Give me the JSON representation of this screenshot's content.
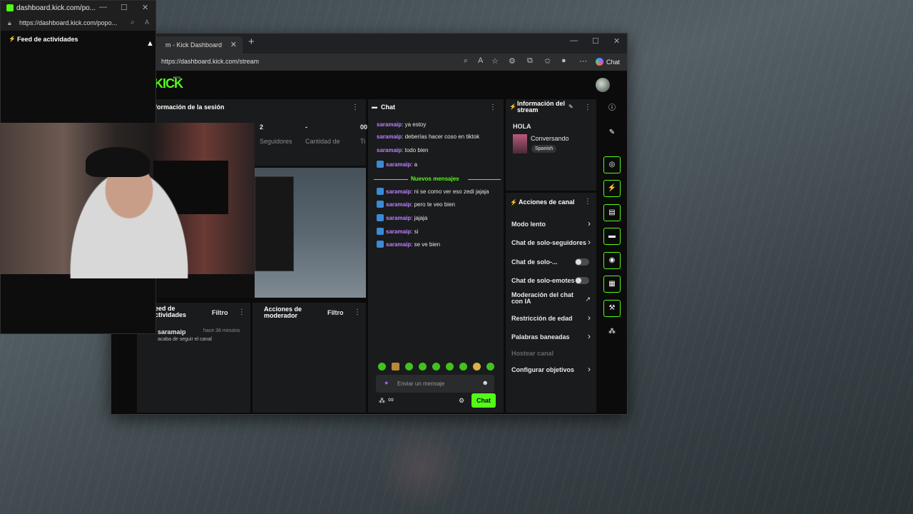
{
  "popup": {
    "title": "dashboard.kick.com/po...",
    "url": "https://dashboard.kick.com/popo...",
    "panel_title": "Feed de actividades"
  },
  "browser": {
    "tab_title": "m - Kick Dashboard",
    "url": "https://dashboard.kick.com/stream",
    "copilot_label": "Chat"
  },
  "kick": {
    "logo": "KICK",
    "beta": "BETA"
  },
  "session": {
    "title": "formación de la sesión",
    "stats": [
      {
        "value": "2",
        "label": "Seguidores"
      },
      {
        "value": "-",
        "label": "Cantidad de"
      },
      {
        "value": "00",
        "label": "Ti"
      }
    ]
  },
  "feed": {
    "title": "eed de\nctividades",
    "filter": "Filtro",
    "item_user": "saramaip",
    "item_time": "hace 38 minutos",
    "item_text": "acaba de seguir el canal"
  },
  "mod": {
    "title": "Acciones de\nmoderador",
    "filter": "Filtro"
  },
  "chat": {
    "title": "Chat",
    "messages_before": [
      {
        "user": "saramaip",
        "text": ": ya estoy",
        "badge": false
      },
      {
        "user": "saramaip",
        "text": ": deberías hacer coso en tiktok",
        "badge": false
      },
      {
        "user": "saramaip",
        "text": ": todo bien",
        "badge": false
      },
      {
        "user": "saramaip",
        "text": ": a",
        "badge": true
      }
    ],
    "new_messages_label": "Nuevos mensajes",
    "messages_after": [
      {
        "user": "saramaip",
        "text": ": ni se como ver eso zedi jajaja",
        "badge": true
      },
      {
        "user": "saramaip",
        "text": ": pero te veo bien",
        "badge": true
      },
      {
        "user": "saramaip",
        "text": ": jajaja",
        "badge": true
      },
      {
        "user": "saramaip",
        "text": ": si",
        "badge": true
      },
      {
        "user": "saramaip",
        "text": ": se ve bien",
        "badge": true
      }
    ],
    "input_placeholder": "Enviar un mensaje",
    "send_label": "Chat",
    "infinity": "∞"
  },
  "stream_info": {
    "title": "Información del\nstream",
    "stream_title": "HOLA",
    "category": "Conversando",
    "language": "Spanish"
  },
  "channel_actions": {
    "title": "Acciones de canal",
    "items": [
      {
        "label": "Modo lento",
        "kind": "chevron"
      },
      {
        "label": "Chat de solo-seguidores",
        "kind": "chevron"
      },
      {
        "label": "Chat de solo-...",
        "kind": "toggle"
      },
      {
        "label": "Chat de solo-emotes",
        "kind": "toggle"
      },
      {
        "label": "Moderación del chat con IA",
        "kind": "external"
      },
      {
        "label": "Restricción de edad",
        "kind": "chevron"
      },
      {
        "label": "Palabras baneadas",
        "kind": "chevron"
      },
      {
        "label": "Hostear canal",
        "kind": "disabled"
      },
      {
        "label": "Configurar objetivos",
        "kind": "chevron"
      }
    ]
  },
  "icons": {
    "accent": "#53fc18",
    "username_color": "#b882ff",
    "panel_bg": "#1a1b1c"
  }
}
